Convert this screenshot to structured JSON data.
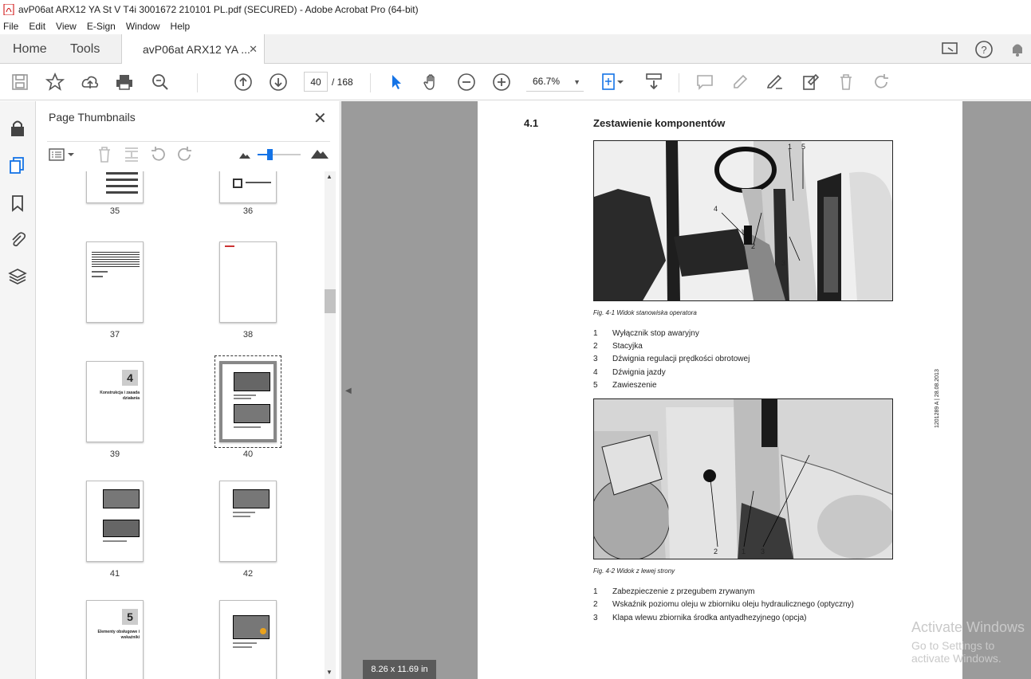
{
  "window": {
    "title": "avP06at ARX12 YA St V T4i 3001672 210101 PL.pdf (SECURED) - Adobe Acrobat Pro (64-bit)"
  },
  "menu": [
    "File",
    "Edit",
    "View",
    "E-Sign",
    "Window",
    "Help"
  ],
  "tabs": {
    "home": "Home",
    "tools": "Tools",
    "document": "avP06at ARX12 YA ..."
  },
  "toolbar": {
    "page_current": "40",
    "page_total": "/  168",
    "zoom": "66.7%"
  },
  "panel": {
    "title": "Page Thumbnails",
    "thumbnails": [
      {
        "label": "35"
      },
      {
        "label": "36"
      },
      {
        "label": "37"
      },
      {
        "label": "38"
      },
      {
        "label": "39",
        "chapter": "4",
        "heading": "Konstrukcja i zasada działania"
      },
      {
        "label": "40"
      },
      {
        "label": "41"
      },
      {
        "label": "42"
      },
      {
        "label": "43",
        "chapter": "5",
        "heading": "Elementy obsługowe i wskaźniki"
      },
      {
        "label": "44"
      }
    ]
  },
  "page_size": "8.26 x 11.69 in",
  "doc": {
    "section_number": "4.1",
    "section_title": "Zestawienie komponentów",
    "fig1_caption": "Fig. 4-1 Widok stanowiska operatora",
    "fig1_callouts": [
      "1",
      "5",
      "4",
      "2",
      "3"
    ],
    "list1": [
      {
        "n": "1",
        "t": "Wyłącznik stop awaryjny"
      },
      {
        "n": "2",
        "t": "Stacyjka"
      },
      {
        "n": "3",
        "t": "Dźwignia regulacji prędkości obrotowej"
      },
      {
        "n": "4",
        "t": "Dźwignia jazdy"
      },
      {
        "n": "5",
        "t": "Zawieszenie"
      }
    ],
    "side_text": "1201289 A | 28.08.2013",
    "fig2_caption": "Fig. 4-2 Widok z lewej strony",
    "fig2_callouts": [
      "2",
      "1",
      "3"
    ],
    "list2": [
      {
        "n": "1",
        "t": "Zabezpieczenie z przegubem zrywanym"
      },
      {
        "n": "2",
        "t": "Wskaźnik poziomu oleju w zbiorniku oleju hydraulicznego (optyczny)"
      },
      {
        "n": "3",
        "t": "Klapa wlewu zbiornika środka antyadhezyjnego (opcja)"
      }
    ]
  },
  "watermark": {
    "line1": "Activate Windows",
    "line2": "Go to Settings to activate Windows."
  }
}
